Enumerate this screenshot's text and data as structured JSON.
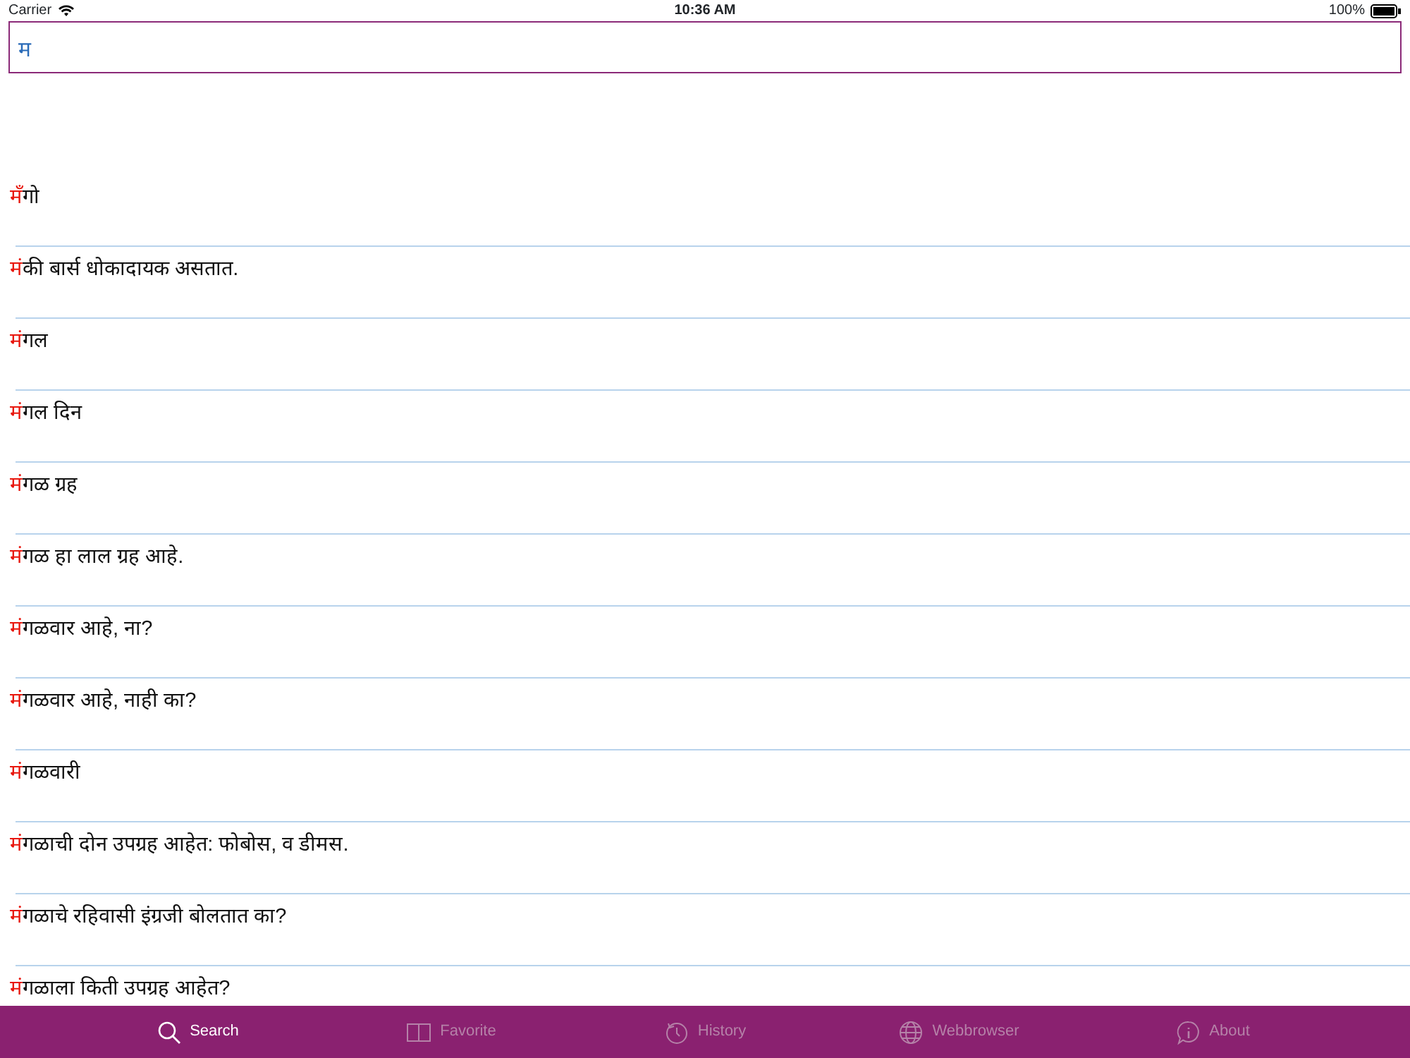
{
  "status_bar": {
    "carrier": "Carrier",
    "time": "10:36 AM",
    "battery": "100%"
  },
  "search": {
    "value": "म"
  },
  "results": [
    {
      "match": "म",
      "rest": "ँगो"
    },
    {
      "match": "म",
      "rest": "ंकी बार्स धोकादायक असतात."
    },
    {
      "match": "म",
      "rest": "ंगल"
    },
    {
      "match": "म",
      "rest": "ंगल दिन"
    },
    {
      "match": "म",
      "rest": "ंगळ ग्रह"
    },
    {
      "match": "म",
      "rest": "ंगळ हा लाल ग्रह आहे."
    },
    {
      "match": "म",
      "rest": "ंगळवार आहे, ना?"
    },
    {
      "match": "म",
      "rest": "ंगळवार आहे, नाही का?"
    },
    {
      "match": "म",
      "rest": "ंगळवारी"
    },
    {
      "match": "म",
      "rest": "ंगळाची दोन उपग्रह आहेत: फोबोस, व डीमस."
    },
    {
      "match": "म",
      "rest": "ंगळाचे रहिवासी इंग्रजी बोलतात का?"
    },
    {
      "match": "म",
      "rest": "ंगळाला किती उपग्रह आहेत?"
    }
  ],
  "tabs": [
    {
      "kind": "search",
      "label": "Search",
      "selected": true
    },
    {
      "kind": "favorite",
      "label": "Favorite",
      "selected": false
    },
    {
      "kind": "history",
      "label": "History",
      "selected": false
    },
    {
      "kind": "web",
      "label": "Webbrowser",
      "selected": false
    },
    {
      "kind": "about",
      "label": "About",
      "selected": false
    }
  ]
}
